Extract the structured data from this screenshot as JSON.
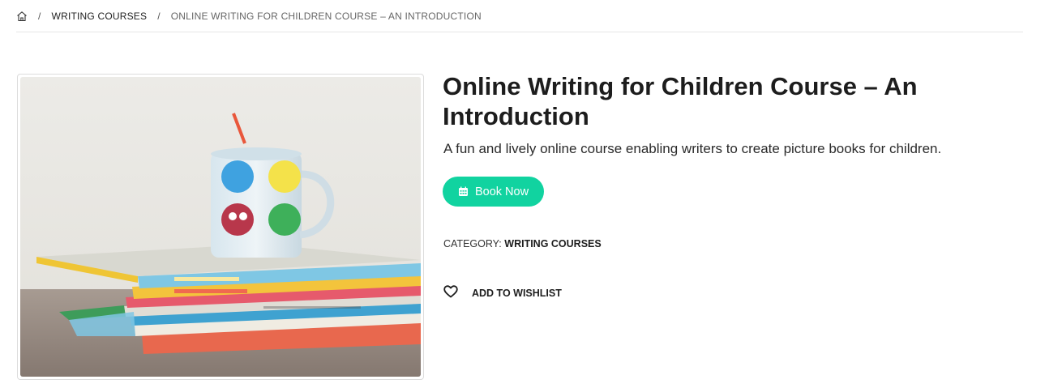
{
  "breadcrumb": {
    "home_icon": "home-icon",
    "separator": "/",
    "items": [
      {
        "label": "Writing Courses"
      },
      {
        "label": "Online Writing for Children Course – An Introduction"
      }
    ]
  },
  "product": {
    "image_description": "mug-and-picture-books-photo",
    "title": "Online Writing for Children Course – An Introduction",
    "subtitle": "A fun and lively online course enabling writers to create picture books for children.",
    "book_button": {
      "label": "Book Now",
      "icon": "calendar-icon",
      "color": "#11d3a0"
    },
    "category": {
      "label": "Category:",
      "value": "Writing Courses"
    },
    "wishlist": {
      "label": "Add to Wishlist",
      "icon": "heart-icon"
    }
  }
}
